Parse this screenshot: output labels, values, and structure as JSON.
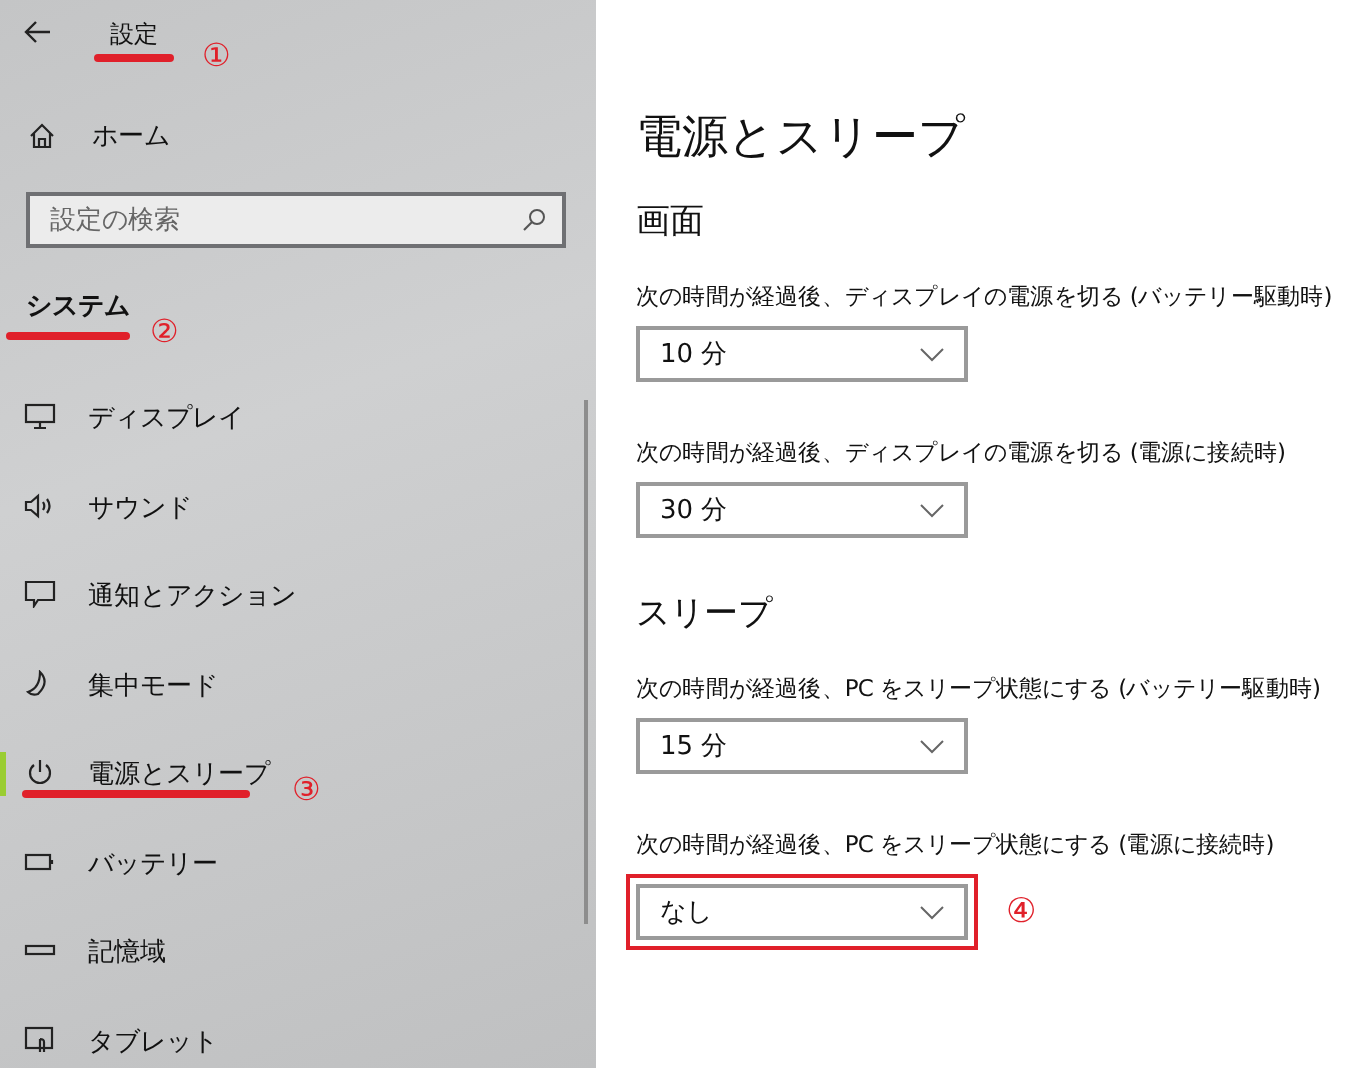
{
  "sidebar": {
    "title": "設定",
    "title_marker": "①",
    "home": "ホーム",
    "search": {
      "placeholder": "設定の検索"
    },
    "section": "システム",
    "section_marker": "②",
    "items": [
      {
        "label": "ディスプレイ",
        "selected": false
      },
      {
        "label": "サウンド",
        "selected": false
      },
      {
        "label": "通知とアクション",
        "selected": false
      },
      {
        "label": "集中モード",
        "selected": false
      },
      {
        "label": "電源とスリープ",
        "selected": true,
        "marker": "③"
      },
      {
        "label": "バッテリー",
        "selected": false
      },
      {
        "label": "記憶域",
        "selected": false
      },
      {
        "label": "タブレット",
        "selected": false
      }
    ]
  },
  "page": {
    "title": "電源とスリープ",
    "sections": [
      {
        "heading": "画面",
        "settings": [
          {
            "label": "次の時間が経過後、ディスプレイの電源を切る (バッテリー駆動時)",
            "value": "10 分"
          },
          {
            "label": "次の時間が経過後、ディスプレイの電源を切る (電源に接続時)",
            "value": "30 分"
          }
        ]
      },
      {
        "heading": "スリープ",
        "settings": [
          {
            "label": "次の時間が経過後、PC をスリープ状態にする (バッテリー駆動時)",
            "value": "15 分"
          },
          {
            "label": "次の時間が経過後、PC をスリープ状態にする (電源に接続時)",
            "value": "なし",
            "marker": "④"
          }
        ]
      }
    ]
  }
}
